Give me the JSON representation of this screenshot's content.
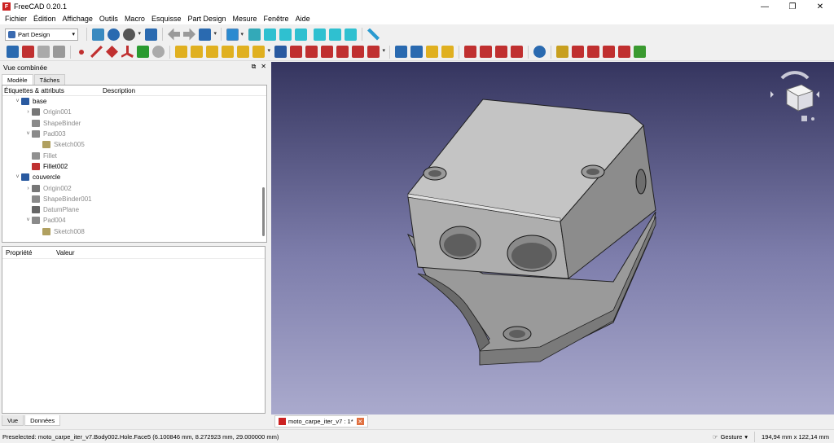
{
  "window": {
    "title": "FreeCAD 0.20.1",
    "logo_text": "F"
  },
  "menu": [
    "Fichier",
    "Édition",
    "Affichage",
    "Outils",
    "Macro",
    "Esquisse",
    "Part Design",
    "Mesure",
    "Fenêtre",
    "Aide"
  ],
  "toolbar": {
    "workbench": "Part Design"
  },
  "panel": {
    "title": "Vue combinée",
    "tabs": [
      "Modèle",
      "Tâches"
    ],
    "tree_headers": {
      "labels": "Étiquettes & attributs",
      "description": "Description"
    },
    "tree": [
      {
        "label": "base",
        "indent": 0,
        "arrow": "v",
        "icon": "body-icon",
        "grey": false
      },
      {
        "label": "Origin001",
        "indent": 1,
        "arrow": ">",
        "icon": "origin-icon",
        "grey": true
      },
      {
        "label": "ShapeBinder",
        "indent": 1,
        "arrow": "",
        "icon": "shapebinder-icon",
        "grey": true
      },
      {
        "label": "Pad003",
        "indent": 1,
        "arrow": "v",
        "icon": "pad-icon",
        "grey": true
      },
      {
        "label": "Sketch005",
        "indent": 2,
        "arrow": "",
        "icon": "sketch-icon",
        "grey": true
      },
      {
        "label": "Fillet",
        "indent": 1,
        "arrow": "",
        "icon": "fillet-icon",
        "grey": true
      },
      {
        "label": "Fillet002",
        "indent": 1,
        "arrow": "",
        "icon": "fillet-active-icon",
        "grey": false
      },
      {
        "label": "couvercle",
        "indent": 0,
        "arrow": "v",
        "icon": "body-icon",
        "grey": false
      },
      {
        "label": "Origin002",
        "indent": 1,
        "arrow": ">",
        "icon": "origin-icon",
        "grey": true
      },
      {
        "label": "ShapeBinder001",
        "indent": 1,
        "arrow": "",
        "icon": "shapebinder-icon",
        "grey": true
      },
      {
        "label": "DatumPlane",
        "indent": 1,
        "arrow": "",
        "icon": "datumplane-icon",
        "grey": true
      },
      {
        "label": "Pad004",
        "indent": 1,
        "arrow": "v",
        "icon": "pad-icon",
        "grey": true
      },
      {
        "label": "Sketch008",
        "indent": 2,
        "arrow": "",
        "icon": "sketch-icon",
        "grey": true
      }
    ],
    "prop_headers": {
      "property": "Propriété",
      "value": "Valeur"
    },
    "bottom_tabs": [
      "Vue",
      "Données"
    ]
  },
  "document_tab": {
    "label": "moto_carpe_iter_v7 : 1*"
  },
  "status": {
    "preselected": "Preselected: moto_carpe_iter_v7.Body002.Hole.Face5 (6.100846 mm, 8.272923 mm, 29.000000 mm)",
    "nav_style": "Gesture",
    "dimensions": "194,94 mm x 122,14 mm"
  },
  "colors": {
    "viewport_top": "#35355f",
    "viewport_bottom": "#aaaacd",
    "part": "#c8c8c8"
  }
}
